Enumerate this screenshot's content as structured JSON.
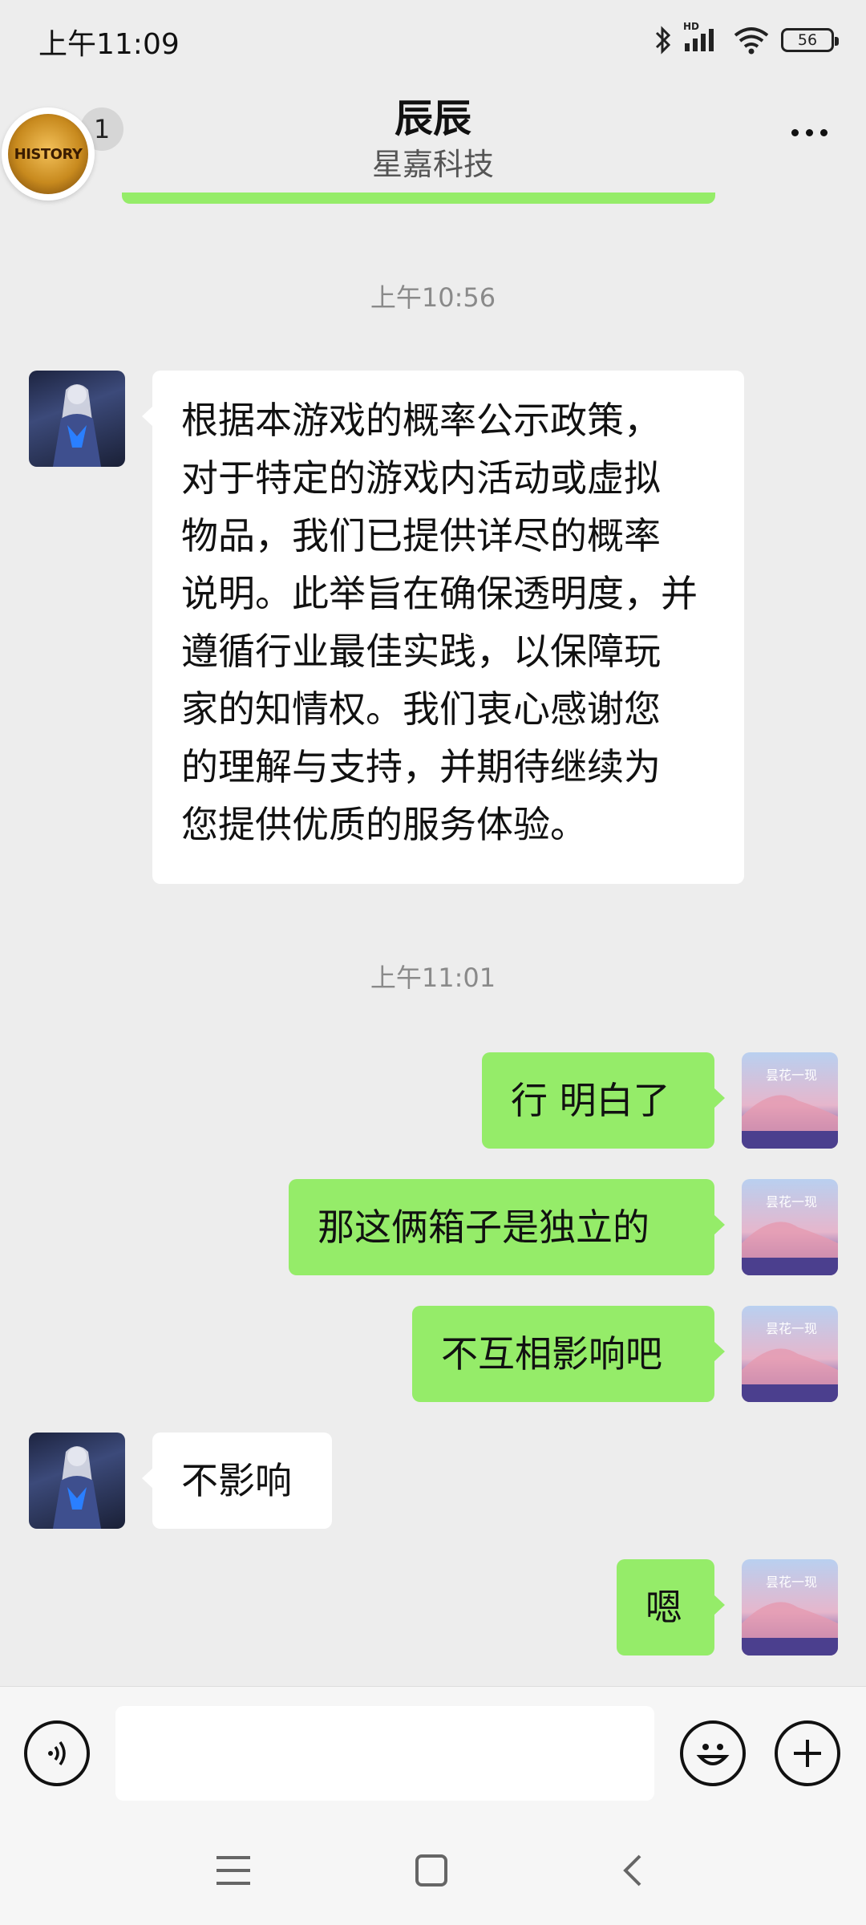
{
  "status_bar": {
    "time": "上午11:09",
    "network_label": "HD",
    "battery": "56"
  },
  "header": {
    "title": "辰辰",
    "subtitle": "星嘉科技",
    "unread_count": "1",
    "floating_avatar_text": "HISTORY"
  },
  "messages": [
    {
      "type": "timestamp",
      "text": "上午10:56"
    },
    {
      "type": "message",
      "side": "left",
      "text": "根据本游戏的概率公示政策，对于特定的游戏内活动或虚拟物品，我们已提供详尽的概率说明。此举旨在确保透明度，并遵循行业最佳实践，以保障玩家的知情权。我们衷心感谢您的理解与支持，并期待继续为您提供优质的服务体验。",
      "lines": [
        "根据本游戏的概率公示政策，",
        "对于特定的游戏内活动或虚拟",
        "物品，我们已提供详尽的概率",
        "说明。此举旨在确保透明度，并",
        "遵循行业最佳实践，以保障玩",
        "家的知情权。我们衷心感谢您",
        "的理解与支持，并期待继续为",
        "您提供优质的服务体验。"
      ]
    },
    {
      "type": "timestamp",
      "text": "上午11:01"
    },
    {
      "type": "message",
      "side": "right",
      "text": "行 明白了"
    },
    {
      "type": "message",
      "side": "right",
      "text": "那这俩箱子是独立的"
    },
    {
      "type": "message",
      "side": "right",
      "text": "不互相影响吧"
    },
    {
      "type": "message",
      "side": "left",
      "text": "不影响"
    },
    {
      "type": "message",
      "side": "right",
      "text": "嗯"
    }
  ],
  "my_avatar_text": "昙花一现",
  "input": {
    "value": "",
    "placeholder": ""
  },
  "icons": {
    "voice": "voice-icon",
    "emoji": "emoji-icon",
    "plus": "plus-icon",
    "more": "more-icon",
    "nav_menu": "menu-icon",
    "nav_home": "home-icon",
    "nav_back": "back-icon"
  },
  "colors": {
    "background": "#ededed",
    "my_bubble": "#95ec69",
    "their_bubble": "#ffffff",
    "timestamp": "#8a8a8a"
  }
}
